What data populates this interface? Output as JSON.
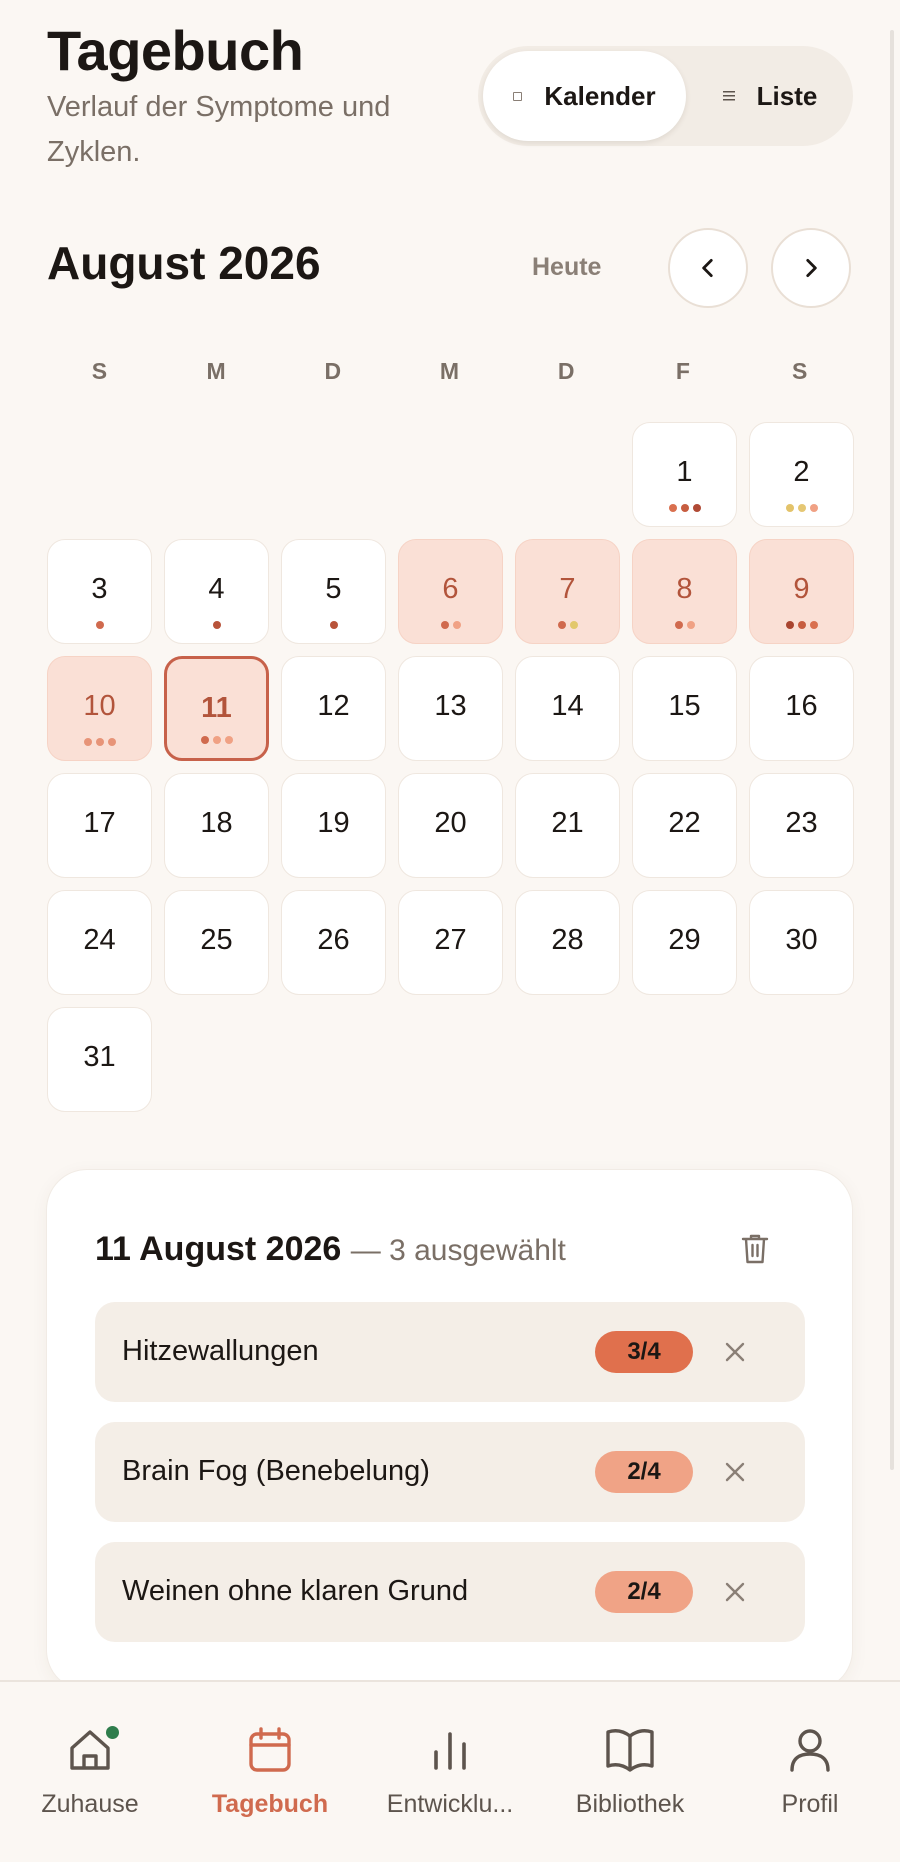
{
  "header": {
    "title": "Tagebuch",
    "subtitle": "Verlauf der Symptome und Zyklen."
  },
  "view_toggle": {
    "calendar_label": "Kalender",
    "list_label": "Liste",
    "active": "calendar"
  },
  "calendar": {
    "month_label": "August 2026",
    "today_label": "Heute",
    "weekdays": [
      "S",
      "M",
      "D",
      "M",
      "D",
      "F",
      "S"
    ],
    "leading_blanks": 5,
    "selected_day": 11,
    "days": [
      {
        "n": "1",
        "state": "normal",
        "dots": [
          "#d9704f",
          "#c75d40",
          "#b04a35"
        ]
      },
      {
        "n": "2",
        "state": "normal",
        "dots": [
          "#e3c36a",
          "#e5c774",
          "#f0a184"
        ]
      },
      {
        "n": "3",
        "state": "normal",
        "dots": [
          "#d06a4e"
        ]
      },
      {
        "n": "4",
        "state": "normal",
        "dots": [
          "#b8533a"
        ]
      },
      {
        "n": "5",
        "state": "normal",
        "dots": [
          "#b8533a"
        ]
      },
      {
        "n": "6",
        "state": "period",
        "dots": [
          "#d06a4e",
          "#f0a184"
        ]
      },
      {
        "n": "7",
        "state": "period",
        "dots": [
          "#d06a4e",
          "#e2c86c"
        ]
      },
      {
        "n": "8",
        "state": "period",
        "dots": [
          "#d06a4e",
          "#f0a184"
        ]
      },
      {
        "n": "9",
        "state": "period",
        "dots": [
          "#a94530",
          "#c75d40",
          "#d9704f"
        ]
      },
      {
        "n": "10",
        "state": "period",
        "dots": [
          "#e79478",
          "#e79478",
          "#e79478"
        ]
      },
      {
        "n": "11",
        "state": "selected",
        "dots": [
          "#d06a4e",
          "#f0a184",
          "#f0a184"
        ]
      },
      {
        "n": "12",
        "state": "normal",
        "dots": []
      },
      {
        "n": "13",
        "state": "normal",
        "dots": []
      },
      {
        "n": "14",
        "state": "normal",
        "dots": []
      },
      {
        "n": "15",
        "state": "normal",
        "dots": []
      },
      {
        "n": "16",
        "state": "normal",
        "dots": []
      },
      {
        "n": "17",
        "state": "normal",
        "dots": []
      },
      {
        "n": "18",
        "state": "normal",
        "dots": []
      },
      {
        "n": "19",
        "state": "normal",
        "dots": []
      },
      {
        "n": "20",
        "state": "normal",
        "dots": []
      },
      {
        "n": "21",
        "state": "normal",
        "dots": []
      },
      {
        "n": "22",
        "state": "normal",
        "dots": []
      },
      {
        "n": "23",
        "state": "normal",
        "dots": []
      },
      {
        "n": "24",
        "state": "normal",
        "dots": []
      },
      {
        "n": "25",
        "state": "normal",
        "dots": []
      },
      {
        "n": "26",
        "state": "normal",
        "dots": []
      },
      {
        "n": "27",
        "state": "normal",
        "dots": []
      },
      {
        "n": "28",
        "state": "normal",
        "dots": []
      },
      {
        "n": "29",
        "state": "normal",
        "dots": []
      },
      {
        "n": "30",
        "state": "normal",
        "dots": []
      },
      {
        "n": "31",
        "state": "normal",
        "dots": []
      }
    ]
  },
  "detail": {
    "date": "11 August 2026",
    "selected_count": "— 3 ausgewählt",
    "symptoms": [
      {
        "label": "Hitzewallungen",
        "severity": "3/4",
        "color": "#e0704d"
      },
      {
        "label": "Brain Fog (Benebelung)",
        "severity": "2/4",
        "color": "#f0a386"
      },
      {
        "label": "Weinen ohne klaren Grund",
        "severity": "2/4",
        "color": "#f0a386"
      }
    ]
  },
  "bottom_nav": {
    "active": "tagebuch",
    "items": [
      {
        "key": "zuhause",
        "label": "Zuhause",
        "icon": "home-icon"
      },
      {
        "key": "tagebuch",
        "label": "Tagebuch",
        "icon": "calendar-icon"
      },
      {
        "key": "entwicklung",
        "label": "Entwicklu...",
        "icon": "bar-chart-icon"
      },
      {
        "key": "bibliothek",
        "label": "Bibliothek",
        "icon": "book-icon"
      },
      {
        "key": "profil",
        "label": "Profil",
        "icon": "user-icon"
      }
    ]
  },
  "colors": {
    "accent": "#d06a4e",
    "period_bg": "#fae0d6",
    "notification_dot": "#2f7d4c"
  }
}
